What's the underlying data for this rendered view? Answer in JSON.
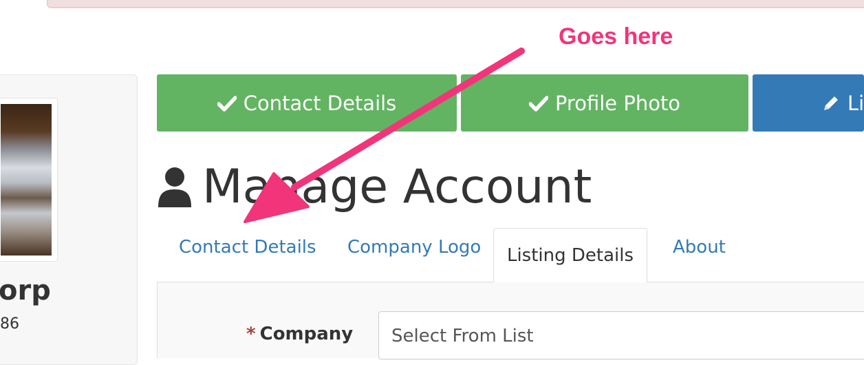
{
  "sidebar": {
    "org_name": "orp",
    "org_number": "86"
  },
  "steps": [
    {
      "label": "Contact Details",
      "state": "complete",
      "icon": "check-icon"
    },
    {
      "label": "Profile Photo",
      "state": "complete",
      "icon": "check-icon"
    },
    {
      "label": "Lis",
      "state": "current",
      "icon": "pencil-icon"
    }
  ],
  "page": {
    "title": "Manage Account",
    "title_icon": "user-icon"
  },
  "tabs": [
    {
      "label": "Contact Details",
      "active": false
    },
    {
      "label": "Company Logo",
      "active": false
    },
    {
      "label": "Listing Details",
      "active": true
    },
    {
      "label": "About",
      "active": false
    }
  ],
  "form": {
    "company_label": "Company",
    "required_marker": "*",
    "company_select_value": "Select From List"
  },
  "annotation": {
    "text": "Goes here",
    "color": "#f2347a"
  },
  "colors": {
    "step_complete": "#62b462",
    "step_current": "#337ab7",
    "link": "#337ab7"
  }
}
